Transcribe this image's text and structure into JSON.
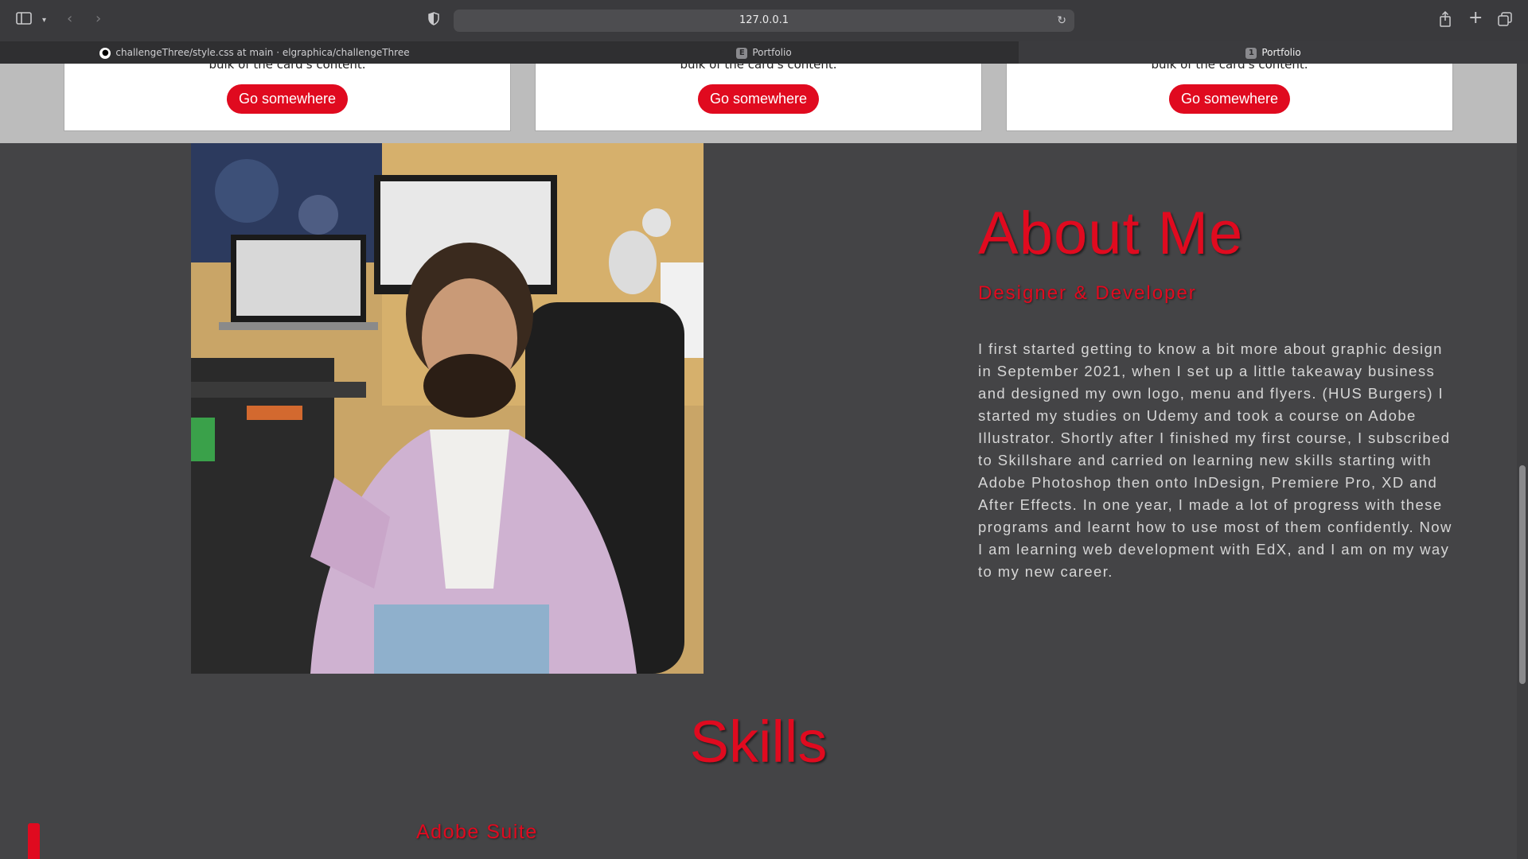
{
  "browser": {
    "address": "127.0.0.1",
    "tabs": [
      {
        "label": "challengeThree/style.css at main · elgraphica/challengeThree",
        "favicon": "github-icon"
      },
      {
        "label": "Portfolio",
        "favicon": "E"
      },
      {
        "label": "Portfolio",
        "favicon": "1"
      }
    ]
  },
  "cards": [
    {
      "text": "bulk of the card's content.",
      "button": "Go somewhere"
    },
    {
      "text": "bulk of the card's content.",
      "button": "Go somewhere"
    },
    {
      "text": "bulk of the card's content.",
      "button": "Go somewhere"
    }
  ],
  "about": {
    "title": "About Me",
    "subtitle": "Designer & Developer",
    "body": "I first started getting to know a bit more about graphic design in September 2021, when I set up a little takeaway business and designed my own logo, menu and flyers. (HUS Burgers) I started my studies on Udemy and took a course on Adobe Illustrator. Shortly after I finished my first course, I subscribed to Skillshare and carried on learning new skills starting with Adobe Photoshop then onto InDesign, Premiere Pro, XD and After Effects. In one year, I made a lot of progress with these programs and learnt how to use most of them confidently. Now I am learning web development with EdX, and I am on my way to my new career."
  },
  "skills": {
    "title": "Skills",
    "items": [
      {
        "label": "Adobe Suite"
      }
    ]
  },
  "colors": {
    "accent": "#e00a1f",
    "page_bg": "#444446",
    "band_bg": "#bcbcbc"
  }
}
